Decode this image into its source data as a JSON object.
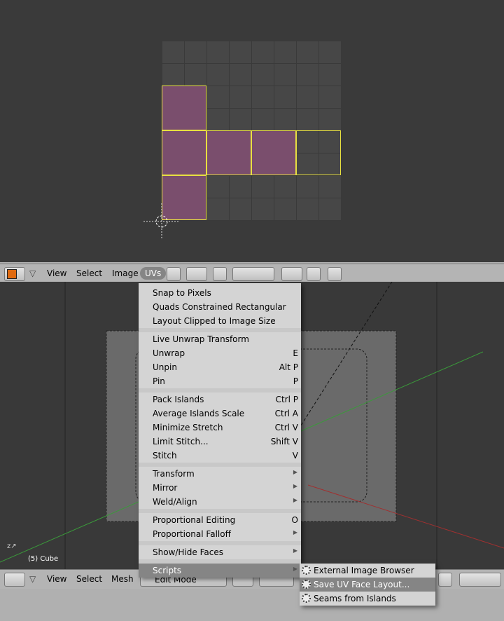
{
  "uv_header": {
    "menus": [
      "View",
      "Select",
      "Image",
      "UVs"
    ]
  },
  "view3d": {
    "object_label": "(5) Cube"
  },
  "view3d_header": {
    "menus": [
      "View",
      "Select",
      "Mesh"
    ],
    "mode": "Edit Mode"
  },
  "uvs_menu": {
    "items": [
      {
        "label": "Snap to Pixels",
        "shortcut": ""
      },
      {
        "label": "Quads Constrained Rectangular",
        "shortcut": ""
      },
      {
        "label": "Layout Clipped to Image Size",
        "shortcut": ""
      },
      {
        "label": "Live Unwrap Transform",
        "shortcut": ""
      },
      {
        "label": "Unwrap",
        "shortcut": "E"
      },
      {
        "label": "Unpin",
        "shortcut": "Alt P"
      },
      {
        "label": "Pin",
        "shortcut": "P"
      },
      {
        "label": "Pack Islands",
        "shortcut": "Ctrl P"
      },
      {
        "label": "Average Islands Scale",
        "shortcut": "Ctrl A"
      },
      {
        "label": "Minimize Stretch",
        "shortcut": "Ctrl V"
      },
      {
        "label": "Limit Stitch...",
        "shortcut": "Shift V"
      },
      {
        "label": "Stitch",
        "shortcut": "V"
      },
      {
        "label": "Transform",
        "shortcut": "",
        "submenu": true
      },
      {
        "label": "Mirror",
        "shortcut": "",
        "submenu": true
      },
      {
        "label": "Weld/Align",
        "shortcut": "",
        "submenu": true
      },
      {
        "label": "Proportional Editing",
        "shortcut": "O"
      },
      {
        "label": "Proportional Falloff",
        "shortcut": "",
        "submenu": true
      },
      {
        "label": "Show/Hide Faces",
        "shortcut": "",
        "submenu": true
      },
      {
        "label": "Scripts",
        "shortcut": "",
        "submenu": true,
        "highlighted": true
      }
    ]
  },
  "scripts_submenu": {
    "items": [
      {
        "label": "External Image Browser"
      },
      {
        "label": "Save UV Face Layout...",
        "highlighted": true
      },
      {
        "label": "Seams from Islands"
      }
    ]
  },
  "colors": {
    "selected_face": "#7a4e6d",
    "face_edge": "#e8e040",
    "highlight": "#858585"
  }
}
